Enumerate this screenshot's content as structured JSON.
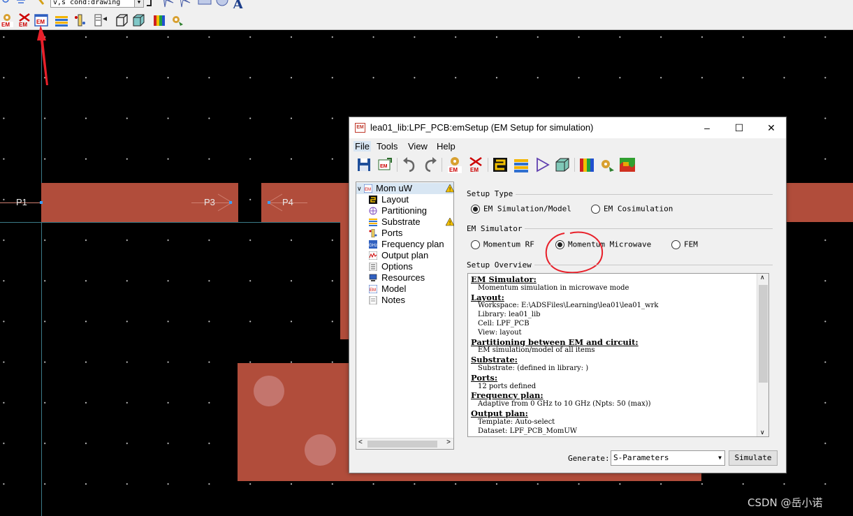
{
  "top_toolbar": {
    "cond_combo_value": "v,s cond:drawing",
    "text_tool_glyph": "A"
  },
  "canvas": {
    "ports": [
      "P1",
      "P3",
      "P4"
    ]
  },
  "dialog": {
    "title": "lea01_lib:LPF_PCB:emSetup (EM Setup for simulation)",
    "icon_text": "EM",
    "window_buttons": {
      "minimize": "–",
      "maximize": "☐",
      "close": "✕"
    },
    "menu": {
      "file": "File",
      "tools": "Tools",
      "view": "View",
      "help": "Help"
    },
    "tree": {
      "root": "Mom uW",
      "items": [
        "Layout",
        "Partitioning",
        "Substrate",
        "Ports",
        "Frequency plan",
        "Output plan",
        "Options",
        "Resources",
        "Model",
        "Notes"
      ]
    },
    "setup_type": {
      "title": "Setup Type",
      "options": [
        "EM Simulation/Model",
        "EM Cosimulation"
      ],
      "selected": "EM Simulation/Model"
    },
    "em_simulator": {
      "title": "EM Simulator",
      "options": [
        "Momentum RF",
        "Momentum Microwave",
        "FEM"
      ],
      "selected": "Momentum Microwave"
    },
    "overview": {
      "title": "Setup Overview",
      "lines": [
        {
          "kind": "h",
          "text": "EM Simulator:"
        },
        {
          "kind": "d",
          "text": "Momentum simulation in microwave mode"
        },
        {
          "kind": "h",
          "text": "Layout:"
        },
        {
          "kind": "d",
          "text": "Workspace: E:\\ADSFiles\\Learning\\lea01\\lea01_wrk"
        },
        {
          "kind": "d",
          "text": "Library: lea01_lib"
        },
        {
          "kind": "d",
          "text": "Cell: LPF_PCB"
        },
        {
          "kind": "d",
          "text": "View: layout"
        },
        {
          "kind": "h",
          "text": "Partitioning between EM and circuit:"
        },
        {
          "kind": "d",
          "text": "EM simulation/model of all items"
        },
        {
          "kind": "h",
          "text": "Substrate:"
        },
        {
          "kind": "d",
          "text": "Substrate:  (defined in library: )"
        },
        {
          "kind": "h",
          "text": "Ports:"
        },
        {
          "kind": "d",
          "text": "12 ports defined"
        },
        {
          "kind": "h",
          "text": "Frequency plan:"
        },
        {
          "kind": "d",
          "text": "Adaptive from 0 GHz to 10 GHz (Npts: 50 (max))"
        },
        {
          "kind": "h",
          "text": "Output plan:"
        },
        {
          "kind": "d",
          "text": "Template: Auto-select"
        },
        {
          "kind": "d",
          "text": "Dataset: LPF_PCB_MomUW"
        }
      ]
    },
    "generate_label": "Generate:",
    "generate_value": "S-Parameters",
    "simulate_label": "Simulate"
  },
  "watermark": "CSDN @岳小诺",
  "colors": {
    "copper": "#b14d3b",
    "annotation_red": "#e8202a",
    "canvas_bg": "#000000"
  }
}
